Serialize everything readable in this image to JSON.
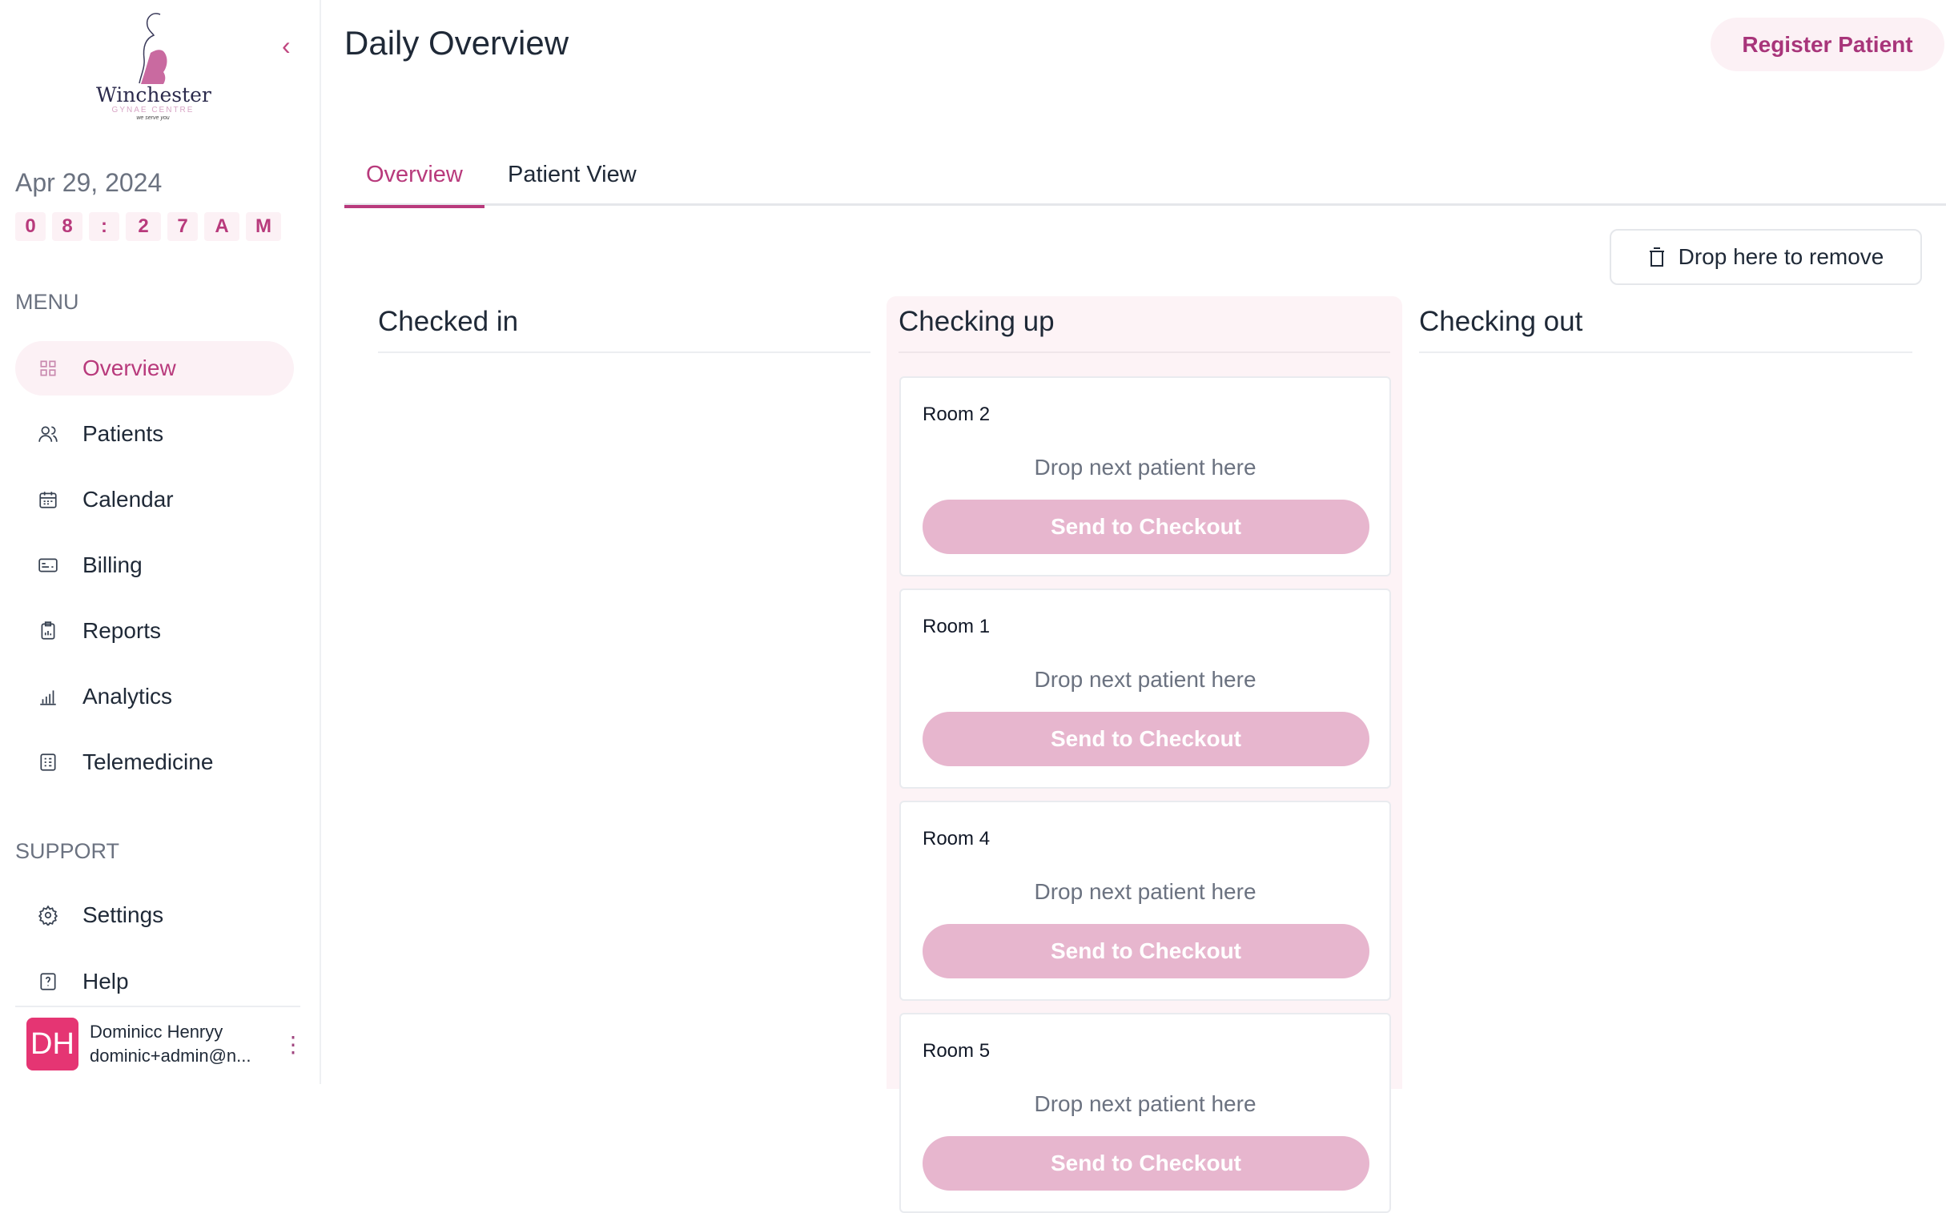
{
  "sidebar": {
    "logo": {
      "name": "Winchester",
      "subtitle": "GYNAE CENTRE",
      "tagline": "we serve you"
    },
    "date": "Apr 29, 2024",
    "time_chars": [
      "0",
      "8",
      ":",
      "2",
      "7",
      "A",
      "M"
    ],
    "menu_label": "MENU",
    "menu": [
      {
        "label": "Overview",
        "icon": "grid-icon"
      },
      {
        "label": "Patients",
        "icon": "users-icon"
      },
      {
        "label": "Calendar",
        "icon": "calendar-icon"
      },
      {
        "label": "Billing",
        "icon": "billing-icon"
      },
      {
        "label": "Reports",
        "icon": "clipboard-icon"
      },
      {
        "label": "Analytics",
        "icon": "bar-chart-icon"
      },
      {
        "label": "Telemedicine",
        "icon": "contact-book-icon"
      }
    ],
    "support_label": "SUPPORT",
    "support": [
      {
        "label": "Settings",
        "icon": "gear-icon"
      },
      {
        "label": "Help",
        "icon": "help-icon"
      }
    ],
    "user": {
      "initials": "DH",
      "name": "Dominicc Henryy",
      "email": "dominic+admin@n..."
    }
  },
  "header": {
    "title": "Daily Overview",
    "register_button": "Register Patient"
  },
  "tabs": [
    {
      "label": "Overview",
      "active": true
    },
    {
      "label": "Patient View",
      "active": false
    }
  ],
  "remove_zone": "Drop here to remove",
  "columns": {
    "checked_in": "Checked in",
    "checking_up": "Checking up",
    "checking_out": "Checking out"
  },
  "rooms": [
    {
      "name": "Room 2",
      "placeholder": "Drop next patient here",
      "button": "Send to Checkout"
    },
    {
      "name": "Room 1",
      "placeholder": "Drop next patient here",
      "button": "Send to Checkout"
    },
    {
      "name": "Room 4",
      "placeholder": "Drop next patient here",
      "button": "Send to Checkout"
    },
    {
      "name": "Room 5",
      "placeholder": "Drop next patient here",
      "button": "Send to Checkout"
    }
  ],
  "colors": {
    "accent": "#b83a7c",
    "accent_soft": "#fcf1f5",
    "button_disabled": "#e7b6ce",
    "avatar": "#e53573"
  }
}
